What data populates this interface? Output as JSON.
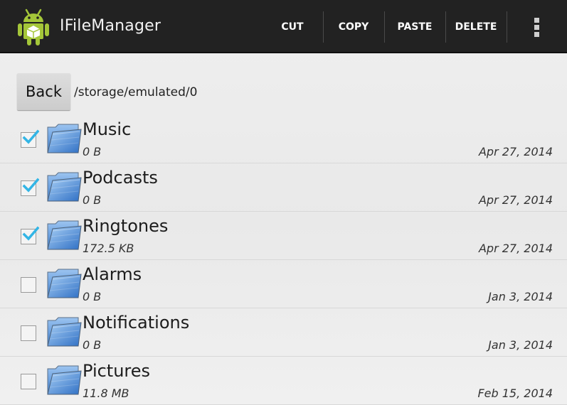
{
  "app": {
    "title": "IFileManager"
  },
  "actions": {
    "cut": "CUT",
    "copy": "COPY",
    "paste": "PASTE",
    "delete": "DELETE",
    "overflow_icon": "overflow-menu-icon"
  },
  "navigation": {
    "back_label": "Back",
    "path": "/storage/emulated/0"
  },
  "files": [
    {
      "name": "Music",
      "size": "0 B",
      "date": "Apr 27, 2014",
      "checked": true
    },
    {
      "name": "Podcasts",
      "size": "0 B",
      "date": "Apr 27, 2014",
      "checked": true
    },
    {
      "name": "Ringtones",
      "size": "172.5 KB",
      "date": "Apr 27, 2014",
      "checked": true
    },
    {
      "name": "Alarms",
      "size": "0 B",
      "date": "Jan 3, 2014",
      "checked": false
    },
    {
      "name": "Notifications",
      "size": "0 B",
      "date": "Jan 3, 2014",
      "checked": false
    },
    {
      "name": "Pictures",
      "size": "11.8 MB",
      "date": "Feb 15, 2014",
      "checked": false
    }
  ],
  "colors": {
    "action_bar": "#222222",
    "check_accent": "#33b5e5",
    "folder_blue": "#4f8fdc"
  },
  "icons": {
    "app": "android-robot-icon",
    "folder": "folder-icon",
    "check": "checkmark-icon"
  }
}
